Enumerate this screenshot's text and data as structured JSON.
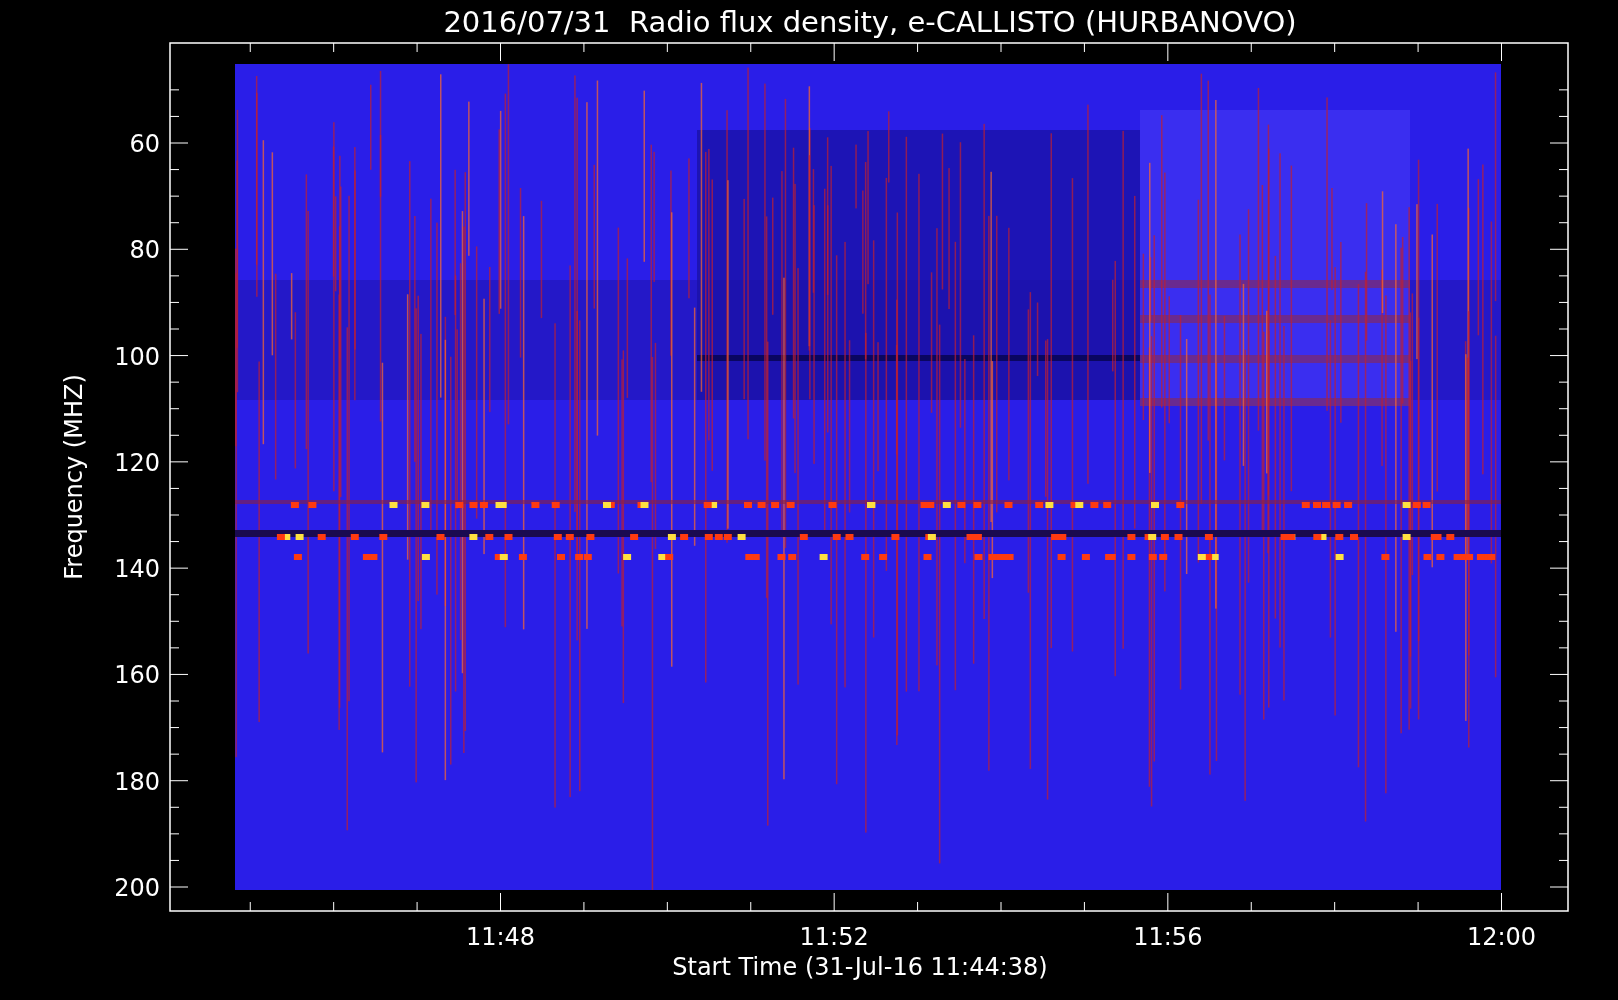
{
  "title": "2016/07/31  Radio flux density, e-CALLISTO (HURBANOVO)",
  "y_axis": {
    "label": "Frequency (MHZ)",
    "ticks": [
      "60",
      "80",
      "100",
      "120",
      "140",
      "160",
      "180",
      "200"
    ]
  },
  "x_axis": {
    "label": "Start Time (31-Jul-16 11:44:38)",
    "ticks": [
      "11:48",
      "11:52",
      "11:56",
      "12:00"
    ]
  }
}
